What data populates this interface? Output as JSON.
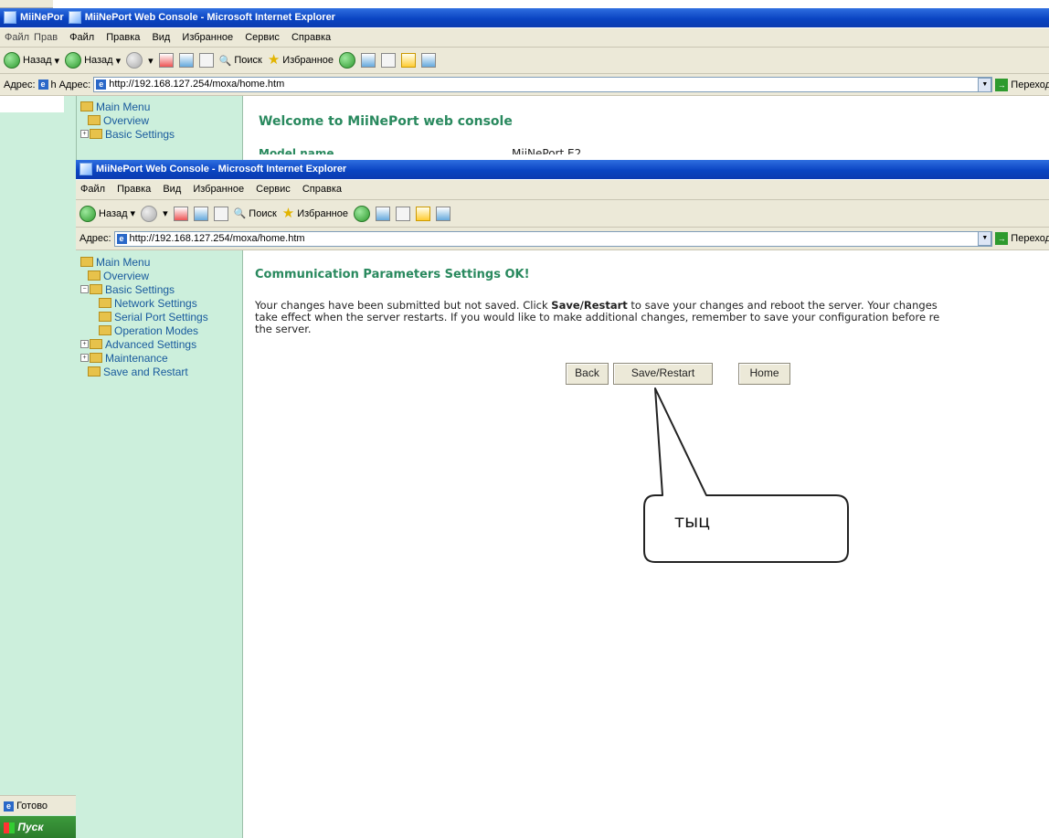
{
  "back_window": {
    "title_left": "MiiNePor",
    "title": "MiiNePort Web Console - Microsoft Internet Explorer",
    "menu_left": [
      "Файл",
      "Прав"
    ],
    "menu": [
      "Файл",
      "Правка",
      "Вид",
      "Избранное",
      "Сервис",
      "Справка"
    ],
    "back_label": "Назад",
    "back_label_2": "Назад",
    "search_label": "Поиск",
    "favorites_label": "Избранное",
    "address_label": "Адрес:",
    "address_label_left": "Адрес:",
    "address_prefix_left": "h",
    "url": "http://192.168.127.254/moxa/home.htm",
    "go_label": "Переход",
    "tree": [
      "Main Menu",
      "Overview",
      "Basic Settings"
    ],
    "welcome": "Welcome to MiiNePort web console",
    "model_name_label": "Model name",
    "model_name_value": "MiiNePort E2",
    "status_ready": "Готово",
    "start_label": "Пуск"
  },
  "front_window": {
    "title": "MiiNePort Web Console - Microsoft Internet Explorer",
    "menu": [
      "Файл",
      "Правка",
      "Вид",
      "Избранное",
      "Сервис",
      "Справка"
    ],
    "back_label": "Назад",
    "search_label": "Поиск",
    "favorites_label": "Избранное",
    "address_label": "Адрес:",
    "url": "http://192.168.127.254/moxa/home.htm",
    "go_label": "Переход",
    "tree": {
      "main_menu": "Main Menu",
      "overview": "Overview",
      "basic_settings": "Basic Settings",
      "network_settings": "Network Settings",
      "serial_port_settings": "Serial Port Settings",
      "operation_modes": "Operation Modes",
      "advanced_settings": "Advanced Settings",
      "maintenance": "Maintenance",
      "save_and_restart": "Save and Restart"
    },
    "heading": "Communication Parameters Settings OK!",
    "message_part1": "Your changes have been submitted but not saved. Click ",
    "message_bold": "Save/Restart",
    "message_part2": " to save your changes and reboot the server. Your changes",
    "message_line2": "take effect when the server restarts. If you would like to make additional changes, remember to save your configuration before re",
    "message_line3": "the server.",
    "buttons": {
      "back": "Back",
      "save_restart": "Save/Restart",
      "home": "Home"
    }
  },
  "annotation": {
    "callout_text": "тыц"
  }
}
